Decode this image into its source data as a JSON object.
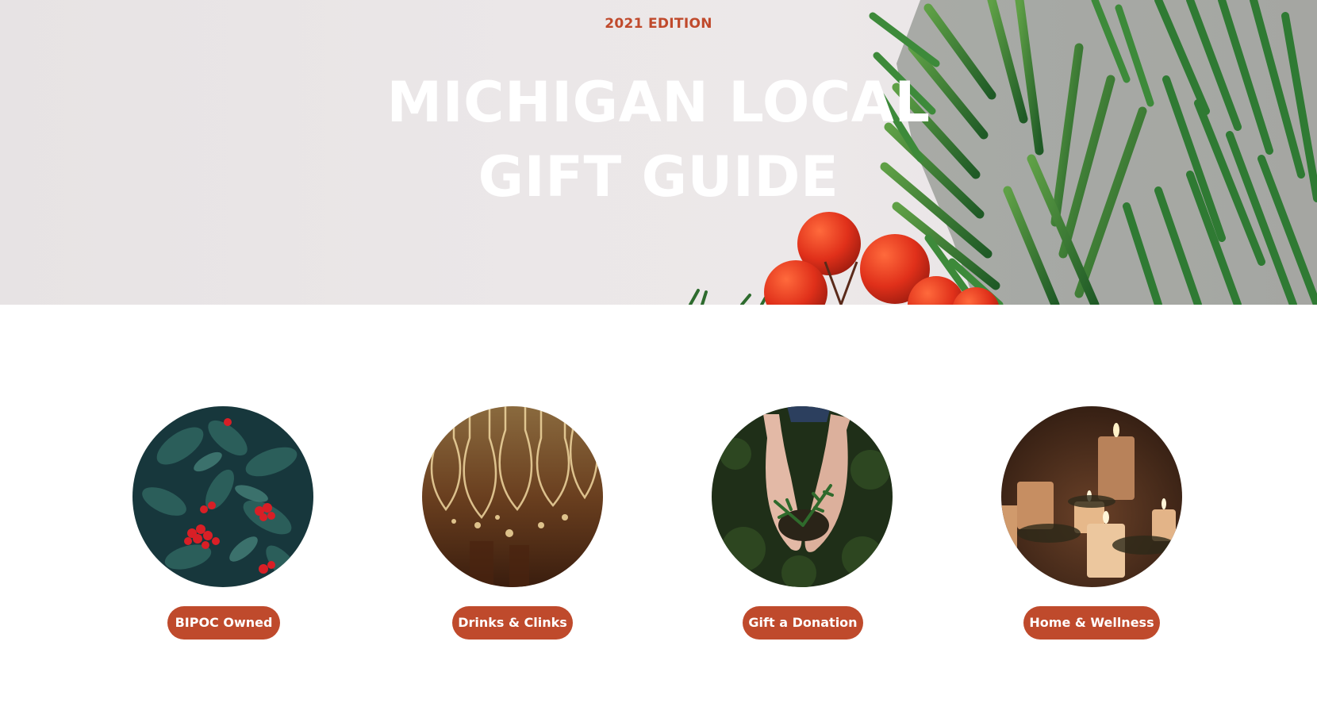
{
  "hero": {
    "edition": "2021 EDITION",
    "title_line1": "MICHIGAN LOCAL",
    "title_line2": "GIFT GUIDE"
  },
  "categories": [
    {
      "label": "BIPOC Owned",
      "image": "holly-berries"
    },
    {
      "label": "Drinks & Clinks",
      "image": "hanging-wine-glasses"
    },
    {
      "label": "Gift a Donation",
      "image": "hands-holding-seedling"
    },
    {
      "label": "Home & Wellness",
      "image": "lit-candles"
    }
  ],
  "colors": {
    "accent": "#bf4a2c",
    "hero_background": "#e9e5e6",
    "title_text": "#ffffff"
  }
}
